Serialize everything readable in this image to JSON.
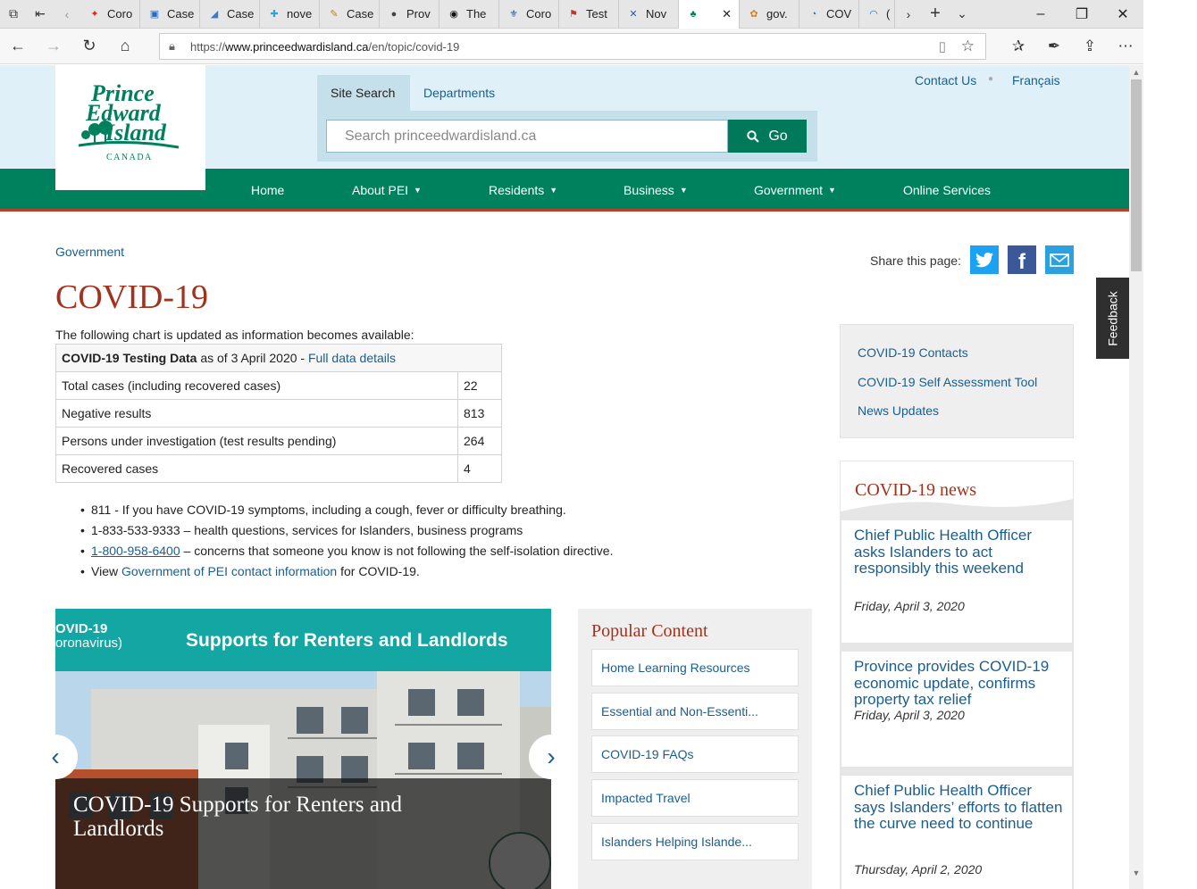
{
  "browser": {
    "tabs": [
      {
        "label": "Coro",
        "fav_color": "#d52b1e",
        "fav_glyph": "✦"
      },
      {
        "label": "Case",
        "fav_color": "#2a6bbf",
        "fav_glyph": "▣"
      },
      {
        "label": "Case",
        "fav_color": "#3a7cc8",
        "fav_glyph": "◢"
      },
      {
        "label": "nove",
        "fav_color": "#2aa6d5",
        "fav_glyph": "✚"
      },
      {
        "label": "Case",
        "fav_color": "#b0892a",
        "fav_glyph": "✎"
      },
      {
        "label": "Prov",
        "fav_color": "#444444",
        "fav_glyph": "●"
      },
      {
        "label": "The",
        "fav_color": "#111111",
        "fav_glyph": "◉"
      },
      {
        "label": "Coro",
        "fav_color": "#2452a8",
        "fav_glyph": "⚜"
      },
      {
        "label": "Test",
        "fav_color": "#c0392b",
        "fav_glyph": "⚑"
      },
      {
        "label": "Nov",
        "fav_color": "#2a5aa8",
        "fav_glyph": "✕"
      },
      {
        "label": "",
        "fav_color": "#00815d",
        "fav_glyph": "♣"
      },
      {
        "label": "gov.",
        "fav_color": "#e07b1a",
        "fav_glyph": "✿"
      },
      {
        "label": "COV",
        "fav_color": "#2a6bbf",
        "fav_glyph": "◔"
      },
      {
        "label": "(",
        "fav_color": "#2a6bbf",
        "fav_glyph": "◠"
      }
    ],
    "url": "https://www.princeedwardisland.ca/en/topic/covid-19",
    "url_host": "www.princeedwardisland.ca",
    "url_prefix": "https://",
    "url_path": "/en/topic/covid-19"
  },
  "header": {
    "logo_text": "Prince Edward Island",
    "logo_sub": "CANADA",
    "contact_us": "Contact Us",
    "francais": "Français",
    "search_tab": "Site Search",
    "departments_tab": "Departments",
    "search_placeholder": "Search princeedwardisland.ca",
    "go_label": "Go"
  },
  "nav": {
    "items": [
      {
        "label": "Home",
        "dropdown": false
      },
      {
        "label": "About PEI",
        "dropdown": true
      },
      {
        "label": "Residents",
        "dropdown": true
      },
      {
        "label": "Business",
        "dropdown": true
      },
      {
        "label": "Government",
        "dropdown": true
      },
      {
        "label": "Online Services",
        "dropdown": false
      }
    ]
  },
  "breadcrumb": "Government",
  "share": {
    "label": "Share this page:",
    "twitter_color": "#1da1f2",
    "facebook_color": "#3b5998",
    "email_color": "#2da1e0"
  },
  "page_title": "COVID-19",
  "intro": "The following chart is updated as information becomes available:",
  "testing_table": {
    "header_bold": "COVID-19 Testing Data",
    "header_rest": " as of 3 April 2020 - ",
    "header_link": "Full data details",
    "rows": [
      {
        "label": "Total cases (including recovered cases)",
        "value": "22"
      },
      {
        "label": "Negative results",
        "value": "813"
      },
      {
        "label": "Persons under investigation (test results pending)",
        "value": "264"
      },
      {
        "label": "Recovered cases",
        "value": "4"
      }
    ]
  },
  "bullets": {
    "b1": "811 - If you have COVID-19 symptoms, including a cough, fever or difficulty breathing.",
    "b2": "1-833-533-9333 – health questions, services for Islanders, business programs",
    "b3_link": "1-800-958-6400",
    "b3_rest": " – concerns that someone you know is not following the self-isolation directive.",
    "b4_pre": "View ",
    "b4_link": "Government of PEI contact information",
    "b4_rest": " for COVID-19."
  },
  "carousel": {
    "banner_small_1": "OVID-19",
    "banner_small_2": "oronavirus)",
    "banner_big": "Supports for Renters and Landlords",
    "caption": "COVID-19 Supports for Renters and Landlords",
    "prev": "‹",
    "next": "›"
  },
  "popular": {
    "title": "Popular Content",
    "items": [
      "Home Learning Resources",
      "Essential and Non-Essenti...",
      "COVID-19 FAQs",
      "Impacted Travel",
      "Islanders Helping Islande..."
    ]
  },
  "quick_links": [
    "COVID-19 Contacts",
    "COVID-19 Self Assessment Tool",
    "News Updates"
  ],
  "news": {
    "title": "COVID-19 news",
    "items": [
      {
        "title": "Chief Public Health Officer asks Islanders to act responsibly this weekend",
        "date": "Friday, April 3, 2020"
      },
      {
        "title": "Province provides COVID-19 economic update, confirms property tax relief",
        "date": "Friday, April 3, 2020"
      },
      {
        "title": "Chief Public Health Officer says Islanders’ efforts to flatten the curve need to continue",
        "date": "Thursday, April 2, 2020"
      }
    ]
  },
  "feedback": "Feedback"
}
